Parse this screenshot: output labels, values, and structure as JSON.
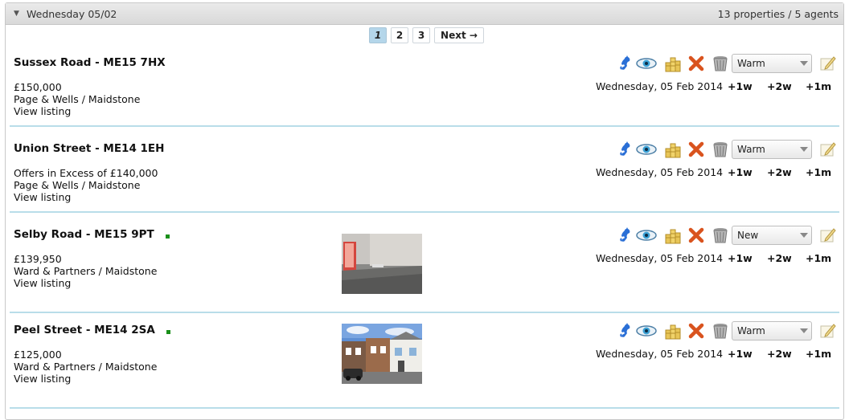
{
  "header": {
    "title": "Wednesday 05/02",
    "summary": "13 properties / 5 agents"
  },
  "pagination": {
    "pages": [
      "1",
      "2",
      "3"
    ],
    "current": "1",
    "next_label": "Next →"
  },
  "actions": {
    "icons": [
      "phone-icon",
      "eye-icon",
      "coins-icon",
      "reject-x-icon",
      "trash-bin-icon",
      "note-pencil-icon"
    ],
    "snooze_labels": [
      "+1w",
      "+2w",
      "+1m"
    ]
  },
  "listings": [
    {
      "title": "Sussex Road - ME15 7HX",
      "price": "£150,000",
      "agent": "Page & Wells / Maidstone",
      "link": "View listing",
      "status": "Warm",
      "date": "Wednesday, 05 Feb 2014",
      "is_new": false,
      "has_photo": false
    },
    {
      "title": "Union Street - ME14 1EH",
      "price": "Offers in Excess of £140,000",
      "agent": "Page & Wells / Maidstone",
      "link": "View listing",
      "status": "Warm",
      "date": "Wednesday, 05 Feb 2014",
      "is_new": false,
      "has_photo": false
    },
    {
      "title": "Selby Road - ME15 9PT",
      "price": "£139,950",
      "agent": "Ward & Partners / Maidstone",
      "link": "View listing",
      "status": "New",
      "date": "Wednesday, 05 Feb 2014",
      "is_new": true,
      "has_photo": true,
      "photo": "interior-room-photo"
    },
    {
      "title": "Peel Street - ME14 2SA",
      "price": "£125,000",
      "agent": "Ward & Partners / Maidstone",
      "link": "View listing",
      "status": "Warm",
      "date": "Wednesday, 05 Feb 2014",
      "is_new": true,
      "has_photo": true,
      "photo": "terraced-houses-photo"
    }
  ],
  "colors": {
    "separator": "#b9dde9",
    "active_page": "#b4d6ea",
    "new_indicator": "#1a8f1a",
    "reject_x": "#d9531e"
  }
}
